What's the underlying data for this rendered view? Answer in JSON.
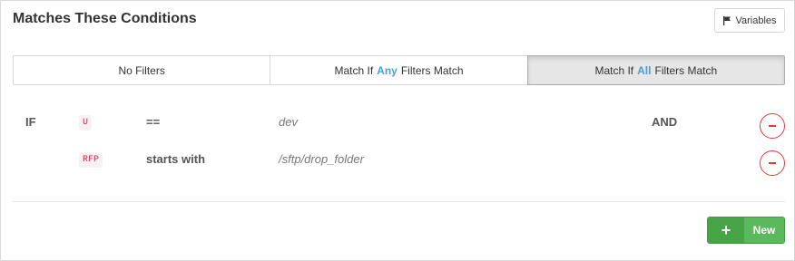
{
  "panel": {
    "title": "Matches These Conditions",
    "variables_button": {
      "label": "Variables",
      "icon": "flag-icon"
    }
  },
  "tabs": [
    {
      "prefix": "No Filters",
      "highlight": "",
      "suffix": "",
      "active": false
    },
    {
      "prefix": "Match If",
      "highlight": "Any",
      "suffix": "Filters Match",
      "active": false
    },
    {
      "prefix": "Match If",
      "highlight": "All",
      "suffix": "Filters Match",
      "active": true
    }
  ],
  "highlight_color": "#4a9fd8",
  "conditions": [
    {
      "keyword": "IF",
      "variable": "U",
      "operator": "==",
      "value": "dev",
      "conjunction": "AND"
    },
    {
      "keyword": "",
      "variable": "RFP",
      "operator": "starts with",
      "value": "/sftp/drop_folder",
      "conjunction": ""
    }
  ],
  "new_button": {
    "label": "New",
    "icon": "plus-icon",
    "color": "#5cb85c"
  },
  "remove_button_color": "#e23b3b"
}
